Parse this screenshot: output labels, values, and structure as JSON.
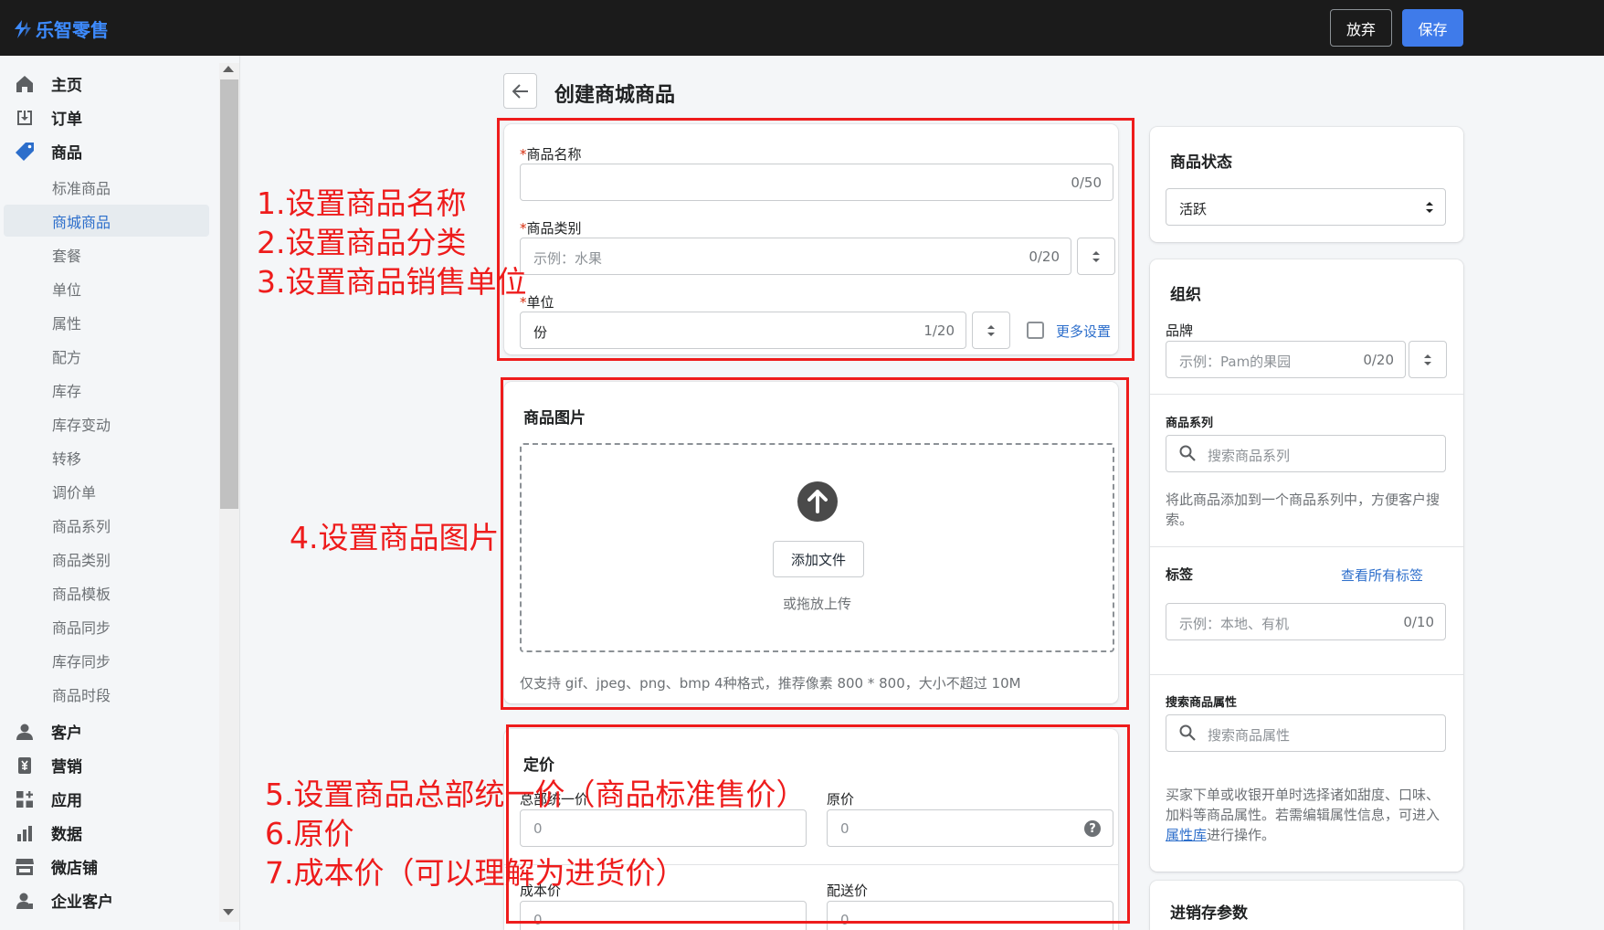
{
  "app": {
    "brand": "乐智零售"
  },
  "toolbar": {
    "discard_label": "放弃",
    "save_label": "保存"
  },
  "sidebar": {
    "main_items": [
      {
        "label": "主页",
        "icon": "home-icon"
      },
      {
        "label": "订单",
        "icon": "orders-icon"
      },
      {
        "label": "商品",
        "icon": "tag-icon"
      }
    ],
    "product_sub_items": [
      {
        "label": "标准商品"
      },
      {
        "label": "商城商品",
        "active": true
      },
      {
        "label": "套餐"
      },
      {
        "label": "单位"
      },
      {
        "label": "属性"
      },
      {
        "label": "配方"
      },
      {
        "label": "库存"
      },
      {
        "label": "库存变动"
      },
      {
        "label": "转移"
      },
      {
        "label": "调价单"
      },
      {
        "label": "商品系列"
      },
      {
        "label": "商品类别"
      },
      {
        "label": "商品模板"
      },
      {
        "label": "商品同步"
      },
      {
        "label": "库存同步"
      },
      {
        "label": "商品时段"
      }
    ],
    "bottom_items": [
      {
        "label": "客户",
        "icon": "person-icon"
      },
      {
        "label": "营销",
        "icon": "marketing-icon"
      },
      {
        "label": "应用",
        "icon": "apps-icon"
      },
      {
        "label": "数据",
        "icon": "chart-icon"
      },
      {
        "label": "微店铺",
        "icon": "store-icon"
      },
      {
        "label": "企业客户",
        "icon": "business-customer-icon"
      }
    ]
  },
  "page": {
    "title": "创建商城商品"
  },
  "basic": {
    "name_label": "商品名称",
    "name_count": "0/50",
    "category_label": "商品类别",
    "category_placeholder": "示例：水果",
    "category_count": "0/20",
    "unit_label": "单位",
    "unit_value": "份",
    "unit_count": "1/20",
    "more_settings": "更多设置",
    "required_mark": "*"
  },
  "images": {
    "title": "商品图片",
    "add_file": "添加文件",
    "drop_hint": "或拖放上传",
    "format_hint": "仅支持 gif、jpeg、png、bmp 4种格式，推荐像素 800 * 800，大小不超过 10M"
  },
  "pricing": {
    "title": "定价",
    "unified_label": "总部统一价",
    "unified_value": "0",
    "original_label": "原价",
    "original_value": "0",
    "cost_label": "成本价",
    "cost_value": "0",
    "delivery_label": "配送价",
    "delivery_value": "0"
  },
  "status": {
    "title": "商品状态",
    "value": "活跃"
  },
  "organization": {
    "title": "组织",
    "brand_label": "品牌",
    "brand_placeholder": "示例：Pam的果园",
    "brand_count": "0/20",
    "series_label": "商品系列",
    "series_placeholder": "搜索商品系列",
    "series_hint": "将此商品添加到一个商品系列中，方便客户搜索。",
    "tags_label": "标签",
    "tags_link": "查看所有标签",
    "tags_placeholder": "示例：本地、有机",
    "tags_count": "0/10",
    "attr_label": "搜索商品属性",
    "attr_placeholder": "搜索商品属性",
    "attr_hint_before": "买家下单或收银开单时选择诸如甜度、口味、加料等商品属性。若需编辑属性信息，可进入",
    "attr_hint_link": "属性库",
    "attr_hint_after": "进行操作。"
  },
  "inventory": {
    "title": "进销存参数"
  },
  "annotations": {
    "step1": "1.设置商品名称",
    "step2": "2.设置商品分类",
    "step3": "3.设置商品销售单位",
    "step4": "4.设置商品图片",
    "step5": "5.设置商品总部统一价（商品标准售价）",
    "step6": "6.原价",
    "step7": "7.成本价（可以理解为进货价）"
  },
  "colors": {
    "accent": "#3f7bea",
    "annotation": "#ee1c1c",
    "link": "#2c6ecb"
  }
}
